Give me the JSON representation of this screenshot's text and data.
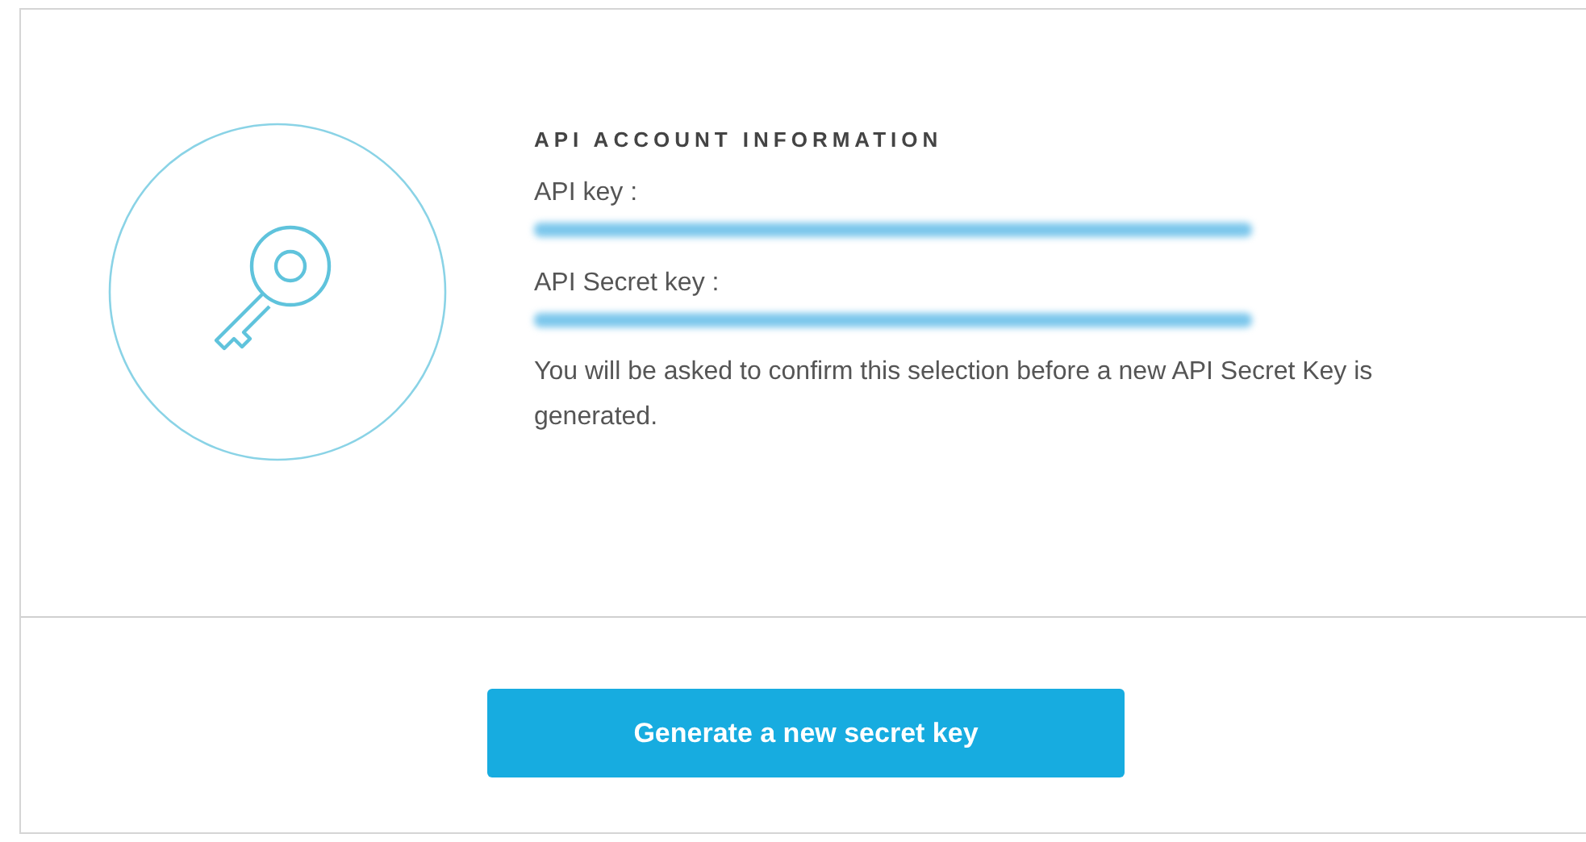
{
  "panel": {
    "heading": "API ACCOUNT INFORMATION",
    "fields": [
      {
        "label": "API key :"
      },
      {
        "label": "API Secret key :"
      }
    ],
    "note": "You will be asked to confirm this selection before a new API Secret Key is generated."
  },
  "footer": {
    "button": "Generate a new secret key"
  }
}
